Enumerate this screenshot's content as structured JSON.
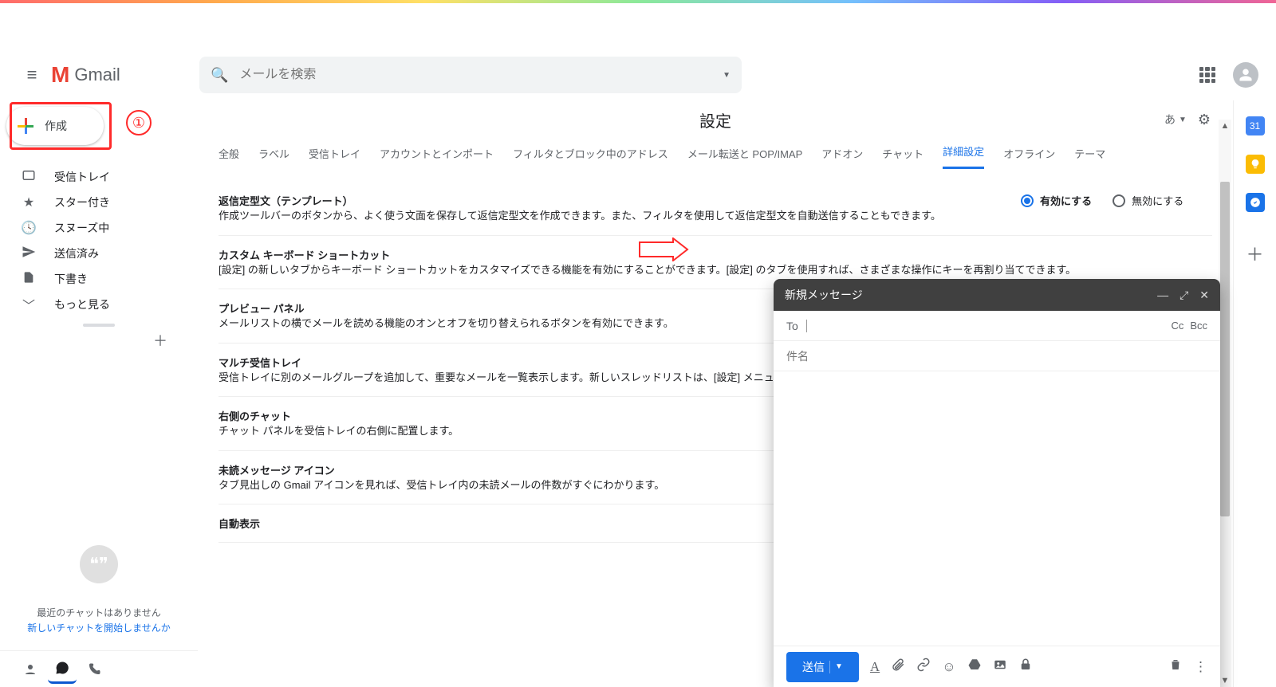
{
  "app_name": "Gmail",
  "search": {
    "placeholder": "メールを検索"
  },
  "compose": {
    "label": "作成"
  },
  "annotation": {
    "number": "①"
  },
  "sidebar": {
    "items": [
      {
        "icon": "☐",
        "label": "受信トレイ"
      },
      {
        "icon": "★",
        "label": "スター付き"
      },
      {
        "icon": "◔",
        "label": "スヌーズ中"
      },
      {
        "icon": "➤",
        "label": "送信済み"
      },
      {
        "icon": "▍",
        "label": "下書き"
      },
      {
        "icon": "﹀",
        "label": "もっと見る"
      }
    ],
    "hangouts_empty": "最近のチャットはありません",
    "hangouts_link": "新しいチャットを開始しませんか"
  },
  "settings": {
    "title": "設定",
    "lang_indicator": "あ",
    "tabs": [
      "全般",
      "ラベル",
      "受信トレイ",
      "アカウントとインポート",
      "フィルタとブロック中のアドレス",
      "メール転送と POP/IMAP",
      "アドオン",
      "チャット",
      "詳細設定",
      "オフライン",
      "テーマ"
    ],
    "active_tab": "詳細設定",
    "radio_enable": "有効にする",
    "radio_disable": "無効にする",
    "rows": [
      {
        "title": "返信定型文（テンプレート）",
        "desc": "作成ツールバーのボタンから、よく使う文面を保存して返信定型文を作成できます。また、フィルタを使用して返信定型文を自動送信することもできます。",
        "has_radio": true,
        "selected": "enable"
      },
      {
        "title": "カスタム キーボード ショートカット",
        "desc": "[設定] の新しいタブからキーボード ショートカットをカスタマイズできる機能を有効にすることができます。[設定] のタブを使用すれば、さまざまな操作にキーを再割り当てできます。",
        "has_radio": false
      },
      {
        "title": "プレビュー パネル",
        "desc": "メールリストの横でメールを読める機能のオンとオフを切り替えられるボタンを有効にできます。",
        "has_radio": false
      },
      {
        "title": "マルチ受信トレイ",
        "desc": "受信トレイに別のメールグループを追加して、重要なメールを一覧表示します。新しいスレッドリストは、[設定] メニューでラベル付きメールやスター付きメール、下書き、お好きな検索条件などに設定できます。",
        "has_radio": false
      },
      {
        "title": "右側のチャット",
        "desc": "チャット パネルを受信トレイの右側に配置します。",
        "has_radio": false
      },
      {
        "title": "未読メッセージ アイコン",
        "desc": "タブ見出しの Gmail アイコンを見れば、受信トレイ内の未読メールの件数がすぐにわかります。",
        "has_radio": false
      },
      {
        "title": "自動表示",
        "desc": "",
        "has_radio": false
      }
    ]
  },
  "compose_window": {
    "title": "新規メッセージ",
    "to_label": "To",
    "cc": "Cc",
    "bcc": "Bcc",
    "subject_placeholder": "件名",
    "send": "送信"
  },
  "right_panel": {
    "calendar": "31"
  }
}
